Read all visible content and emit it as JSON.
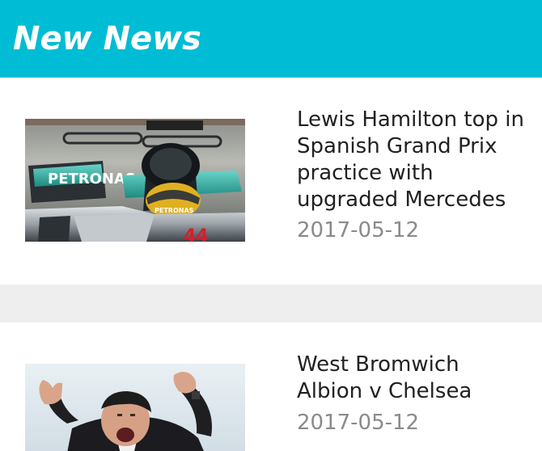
{
  "app_bar": {
    "title": "New News",
    "background": "#00bcd4"
  },
  "articles": [
    {
      "headline": "Lewis Hamilton top in Spanish Grand Prix practice with upgraded Mercedes",
      "date": "2017-05-12",
      "thumbnail_text": [
        "PETRONAS",
        "PETRONAS",
        "44"
      ],
      "thumbnail_icon": "f1-car-photo"
    },
    {
      "headline": "West Bromwich Albion v Chelsea",
      "date": "2017-05-12",
      "thumbnail_icon": "manager-celebrating-photo"
    }
  ],
  "colors": {
    "headline": "#212121",
    "date": "#8a8a8a",
    "divider": "#eeeeee"
  }
}
